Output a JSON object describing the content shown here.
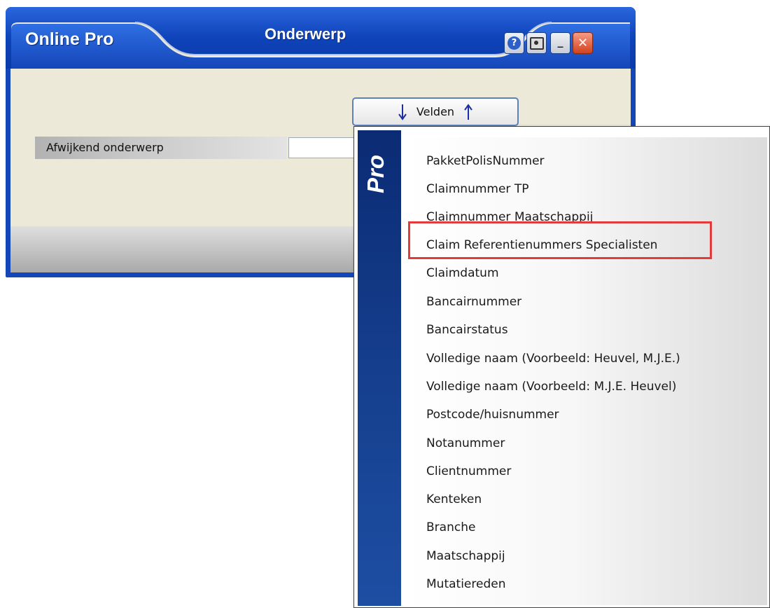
{
  "window": {
    "app_title": "Online Pro",
    "title": "Onderwerp",
    "buttons": {
      "help": "?",
      "minimize": "_",
      "close": "✕"
    }
  },
  "form": {
    "field_label": "Afwijkend onderwerp",
    "field_value": "",
    "velden_button": "Velden"
  },
  "menu": {
    "brand": "Pro",
    "items": [
      "PakketPolisNummer",
      "Claimnummer TP",
      "Claimnummer Maatschappij",
      "Claim Referentienummers Specialisten",
      "Claimdatum",
      "Bancairnummer",
      "Bancairstatus",
      "Volledige naam (Voorbeeld: Heuvel, M.J.E.)",
      "Volledige naam (Voorbeeld: M.J.E. Heuvel)",
      "Postcode/huisnummer",
      "Notanummer",
      "Clientnummer",
      "Kenteken",
      "Branche",
      "Maatschappij",
      "Mutatiereden"
    ],
    "highlighted_item": "Claim Referentienummers Specialisten"
  },
  "colors": {
    "titlebar": "#1446b8",
    "client": "#ece9d8",
    "highlight": "#e23b3b",
    "menu_stripe": "#16408f"
  }
}
